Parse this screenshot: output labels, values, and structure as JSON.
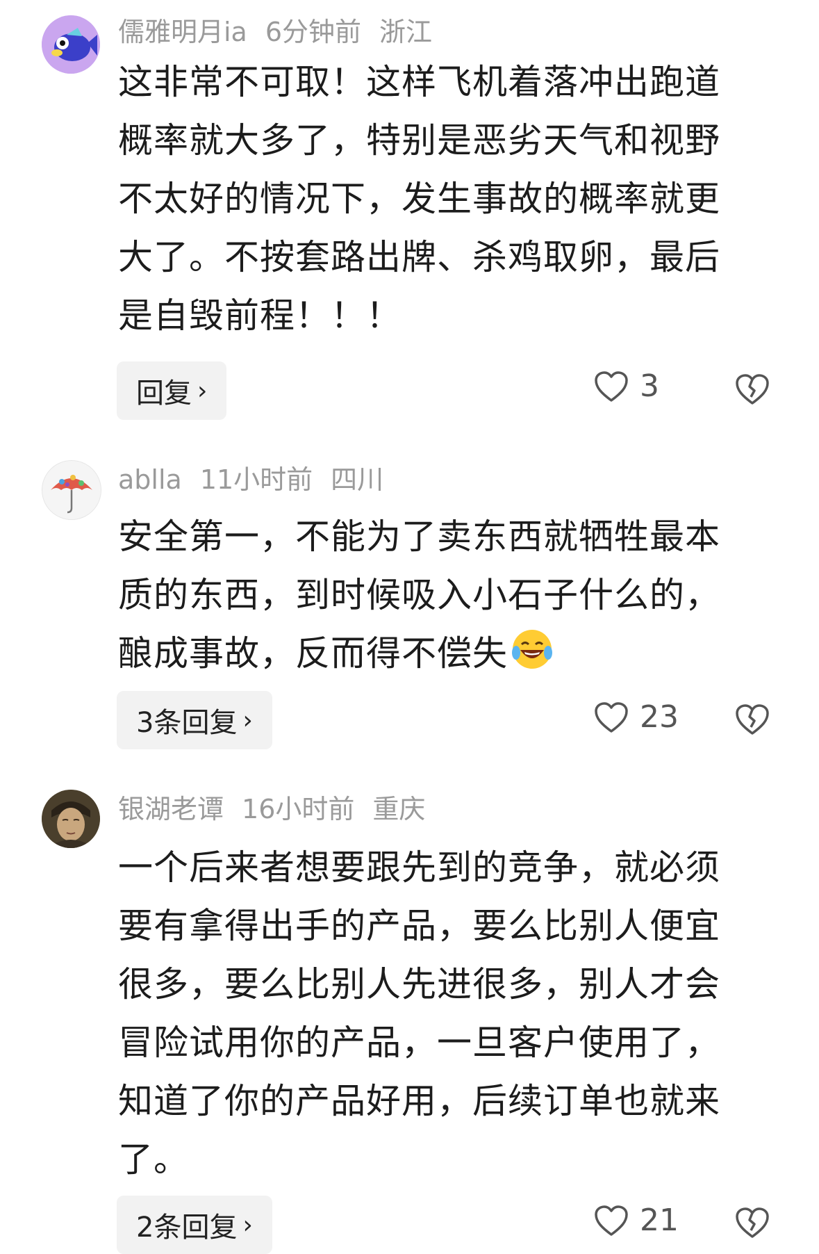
{
  "comments": [
    {
      "username": "儒雅明月ia",
      "time": "6分钟前",
      "location": "浙江",
      "lines": [
        "这非常不可取！这样飞机着落冲出跑道",
        "概率就大多了，特别是恶劣天气和视野",
        "不太好的情况下，发生事故的概率就更",
        "大了。不按套路出牌、杀鸡取卵，最后",
        "是自毁前程！！！"
      ],
      "reply_label": "回复",
      "likes": "3",
      "avatar_icon": "fish-avatar-icon"
    },
    {
      "username": "ablla",
      "time": "11小时前",
      "location": "四川",
      "lines": [
        "安全第一，不能为了卖东西就牺牲最本",
        "质的东西，到时候吸入小石子什么的，",
        "酿成事故，反而得不偿失"
      ],
      "emoji": "laughing-tears-emoji",
      "reply_label": "3条回复",
      "likes": "23",
      "avatar_icon": "umbrella-avatar-icon"
    },
    {
      "username": "银湖老谭",
      "time": "16小时前",
      "location": "重庆",
      "lines": [
        "一个后来者想要跟先到的竞争，就必须",
        "要有拿得出手的产品，要么比别人便宜",
        "很多，要么比别人先进很多，别人才会",
        "冒险试用你的产品，一旦客户使用了，",
        "知道了你的产品好用，后续订单也就来",
        "了。"
      ],
      "reply_label": "2条回复",
      "likes": "21",
      "avatar_icon": "portrait-avatar-icon"
    }
  ],
  "colors": {
    "meta_text": "#9a9a9a",
    "reply_bg": "#f2f2f2",
    "body_text": "#1c1c1c"
  }
}
